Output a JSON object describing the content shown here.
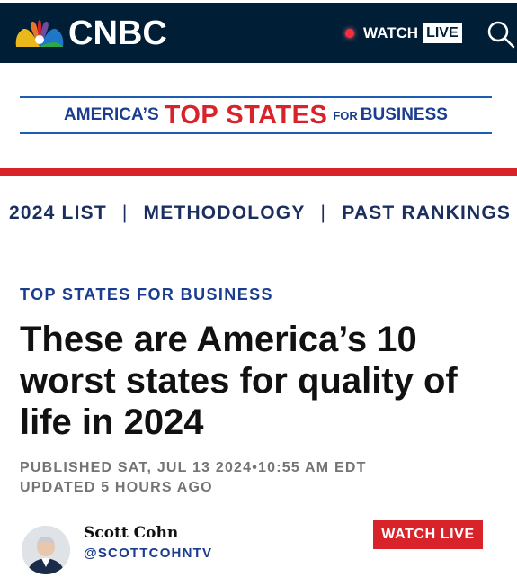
{
  "header": {
    "logo_text": "CNBC",
    "watch_label": "WATCH",
    "live_label": "LIVE",
    "icons": [
      "peacock-logo-icon",
      "live-dot-icon",
      "search-icon"
    ]
  },
  "banner": {
    "part1": "AMERICA’S",
    "part2": "TOP STATES",
    "part3": "FOR",
    "part4": "BUSINESS"
  },
  "subnav": {
    "items": [
      {
        "label": "2024 LIST"
      },
      {
        "label": "METHODOLOGY"
      },
      {
        "label": "PAST RANKINGS"
      }
    ],
    "separator": "|"
  },
  "article": {
    "eyebrow": "TOP STATES FOR BUSINESS",
    "headline": "These are America’s 10 worst states for quality of life in 2024",
    "published": "PUBLISHED SAT, JUL 13 2024•10:55 AM EDT",
    "updated": "UPDATED 5 HOURS AGO",
    "author_name": "Scott Cohn",
    "author_handle": "@SCOTTCOHNTV",
    "watch_live_label": "WATCH LIVE"
  },
  "colors": {
    "header_bg": "#001e36",
    "accent_red": "#d8232a",
    "brand_blue": "#1a3d8f"
  }
}
